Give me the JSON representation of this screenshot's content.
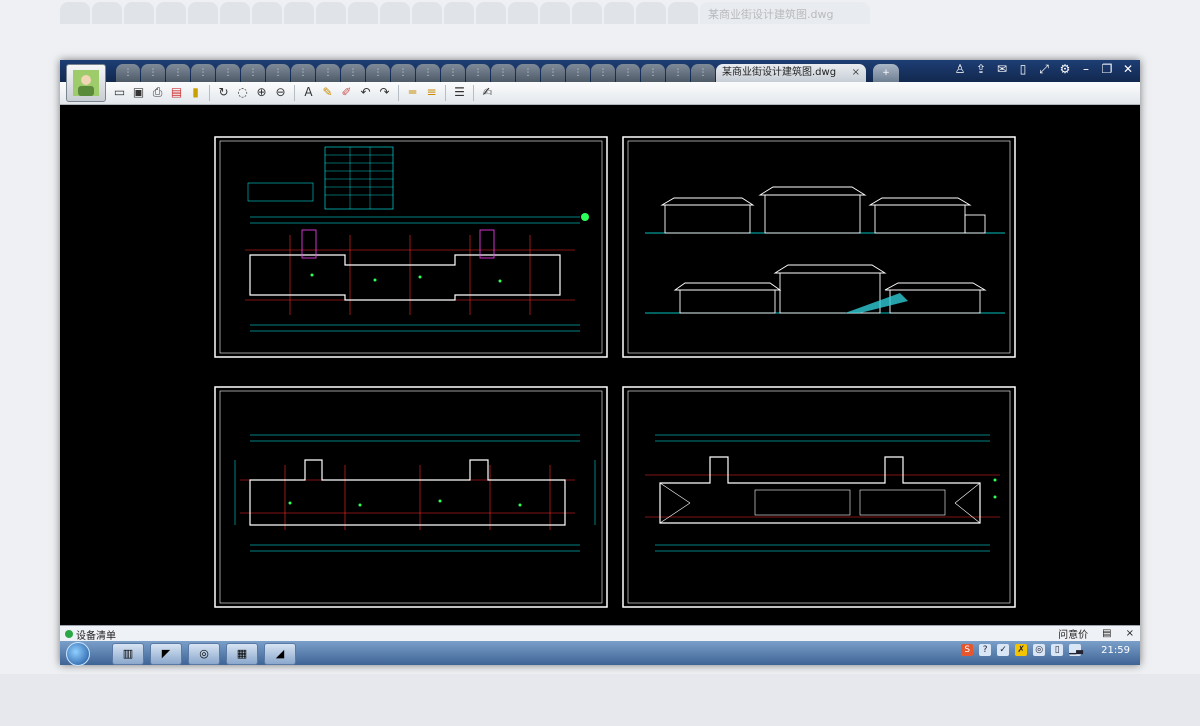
{
  "app": {
    "file_tab": "某商业街设计建筑图.dwg",
    "tab_close": "×",
    "new_tab": "+"
  },
  "toolbar_icons": [
    "open-folder-icon",
    "save-icon",
    "print-icon",
    "export-pdf-icon",
    "lock-icon",
    "rotate-icon",
    "zoom-window-icon",
    "zoom-in-icon",
    "zoom-out-icon",
    "text-icon",
    "pencil-icon",
    "markup-pen-icon",
    "undo-icon",
    "redo-icon",
    "measure-icon",
    "dimension-icon",
    "layers-icon",
    "notes-icon"
  ],
  "window_controls": [
    "user-icon",
    "share-icon",
    "chat-icon",
    "phone-icon",
    "fullscreen-icon",
    "settings-icon",
    "minimize-icon",
    "restore-icon",
    "close-icon"
  ],
  "status": {
    "label": "设备清单",
    "feedback": "问意价",
    "comment_icon": "comment-icon",
    "close": "×"
  },
  "taskbar": {
    "time": "21:59",
    "ime": "S"
  },
  "colors": {
    "titlebar": "#1d3d74",
    "canvas": "#000000",
    "drawing_frame": "#ffffff",
    "cad_cyan": "#00ffff",
    "cad_red": "#ff2b2b",
    "cad_green": "#2bff5a",
    "cad_magenta": "#ff40ff"
  }
}
